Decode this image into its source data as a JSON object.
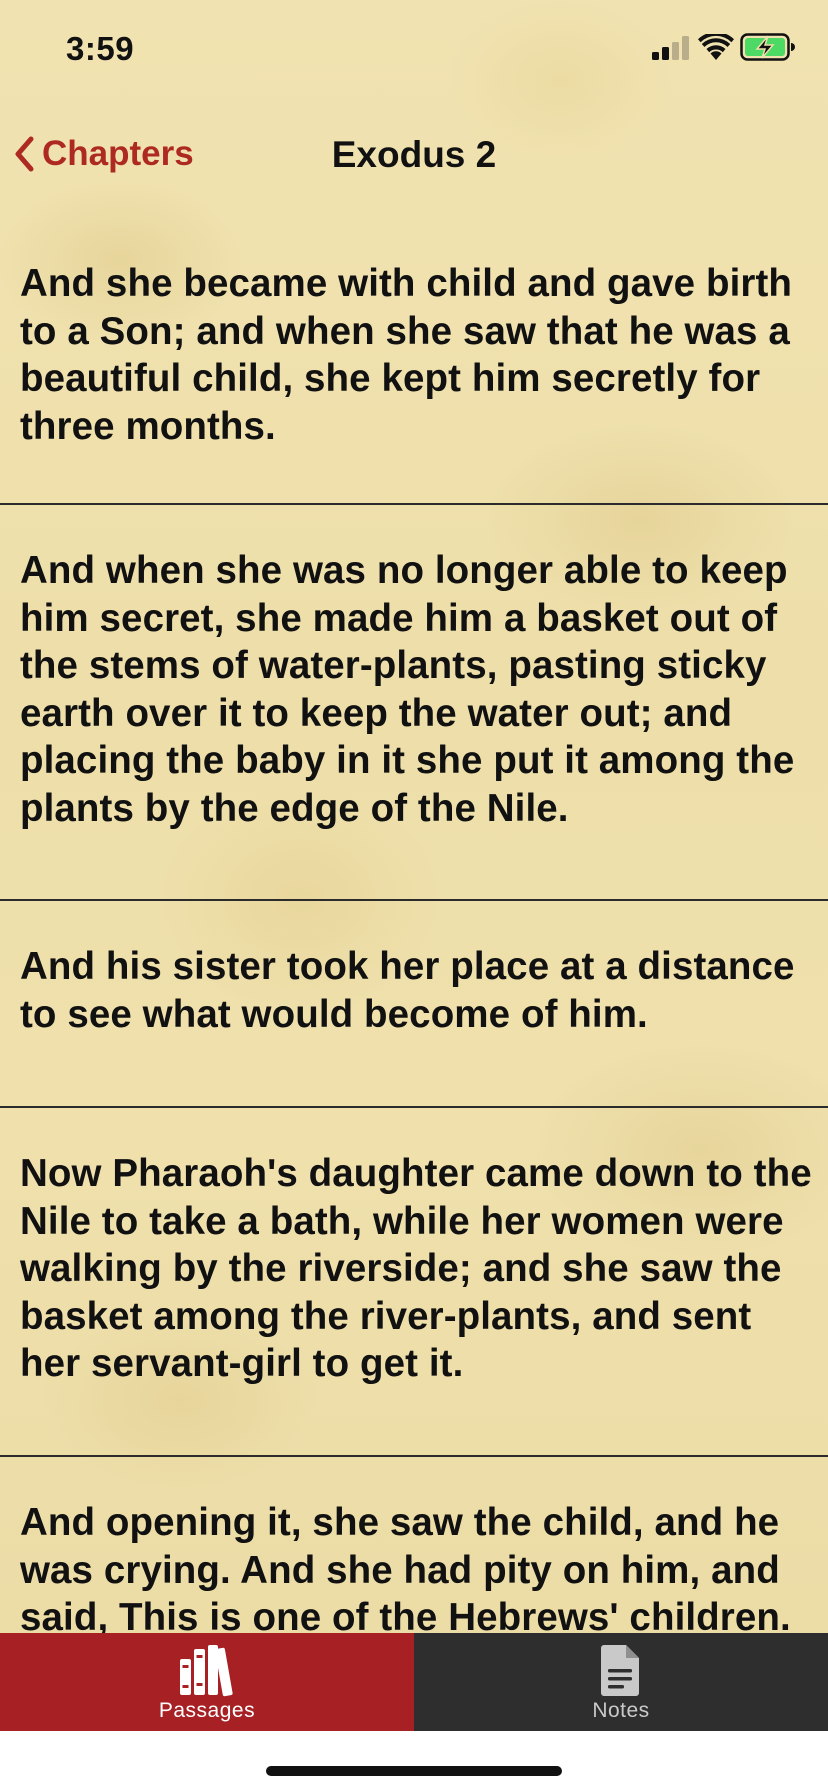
{
  "status_bar": {
    "time": "3:59",
    "signal_icon": "cellular-signal-icon",
    "wifi_icon": "wifi-icon",
    "battery_icon": "battery-charging-icon",
    "battery_color": "#4cd964"
  },
  "nav": {
    "back_label": "Chapters",
    "title": "Exodus 2"
  },
  "verses": [
    "And she became with child and gave birth to a Son; and when she saw that he was a beautiful child, she kept him secretly for three months.",
    "And when she was no longer able to keep him secret, she made him a basket out of the stems of water-plants, pasting sticky earth over it to keep the water out; and placing the baby in it she put it among the plants by the edge of the Nile.",
    "And his sister took her place at a distance to see what would become of him.",
    "Now Pharaoh's daughter came down to the Nile to take a bath, while her women were walking by the riverside; and she saw the basket among the river-plants, and sent her servant-girl to get it.",
    "And opening it, she saw the child, and he was crying. And she had pity on him, and said, This is one of the Hebrews' children."
  ],
  "tabs": [
    {
      "label": "Passages",
      "icon": "books-icon",
      "selected": true
    },
    {
      "label": "Notes",
      "icon": "document-icon",
      "selected": false
    }
  ],
  "colors": {
    "accent": "#ad2a22",
    "tab_selected_bg": "#a62024",
    "tab_unselected_bg": "#2e2e2e",
    "paper": "#efe0ab"
  }
}
